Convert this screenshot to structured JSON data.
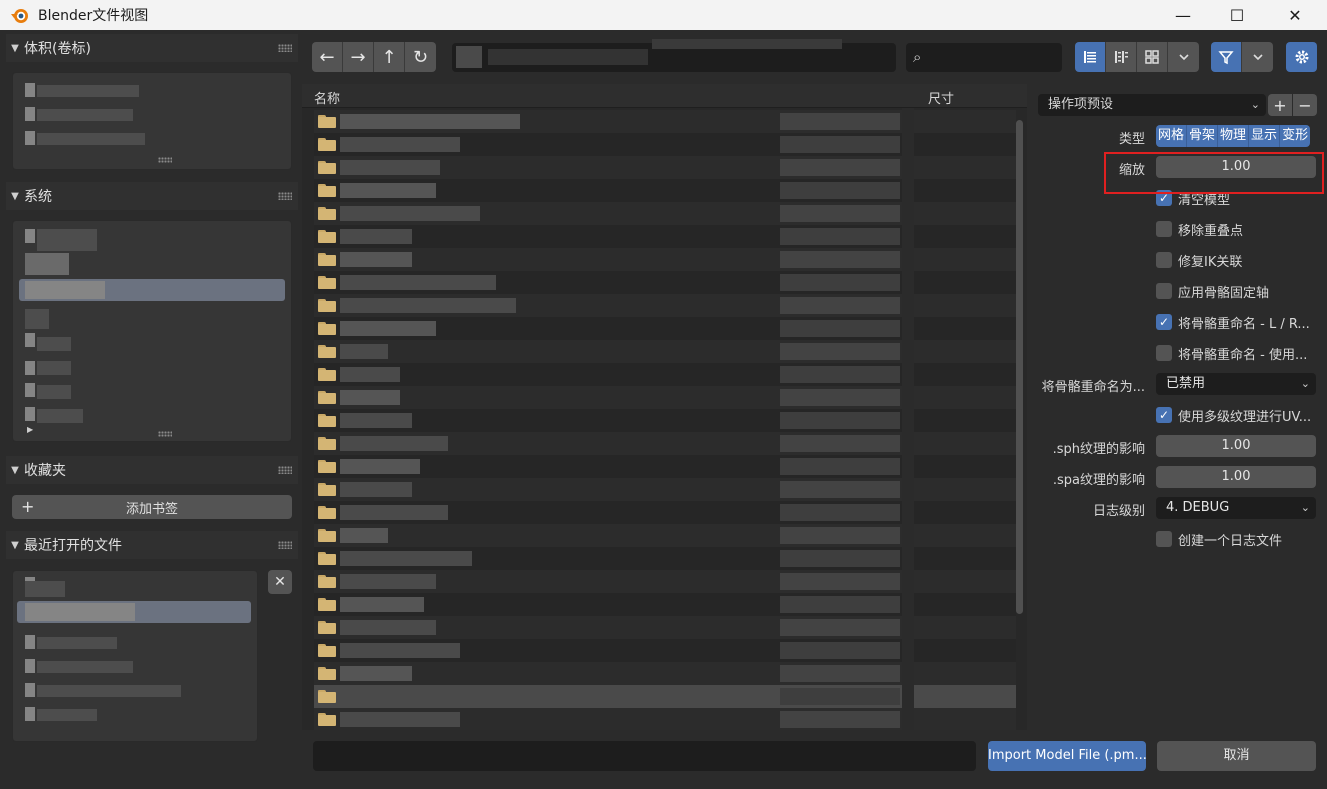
{
  "window": {
    "title": "Blender文件视图",
    "minimize_glyph": "—",
    "maximize_glyph": "☐",
    "close_glyph": "✕"
  },
  "sidebar": {
    "volumes_title": "体积(卷标)",
    "system_title": "系统",
    "favorites_title": "收藏夹",
    "add_bookmark_label": "添加书签",
    "recent_title": "最近打开的文件"
  },
  "toolbar": {
    "nav_icons": [
      "arrow-left-icon",
      "arrow-right-icon",
      "parent-directory-icon",
      "refresh-icon"
    ],
    "nav_glyphs": [
      "←",
      "→",
      "↑",
      "↻"
    ],
    "display_icons": [
      "list-vertical-icon",
      "list-horizontal-icon",
      "thumbnails-icon",
      "display-menu-chevron-icon"
    ],
    "filter_icon": "filter-icon",
    "settings_icon": "gear-icon"
  },
  "filelist": {
    "col_name": "名称",
    "col_size": "尺寸"
  },
  "operator": {
    "preset_label": "操作项预设",
    "type_label": "类型",
    "types": [
      "网格",
      "骨架",
      "物理",
      "显示",
      "变形"
    ],
    "scale_label": "缩放",
    "scale_value": "1.00",
    "checkboxes": [
      {
        "label": "清空模型",
        "checked": true
      },
      {
        "label": "移除重叠点",
        "checked": false
      },
      {
        "label": "修复IK关联",
        "checked": false
      },
      {
        "label": "应用骨骼固定轴",
        "checked": false
      },
      {
        "label": "将骨骼重命名 - L / R...",
        "checked": true
      },
      {
        "label": "将骨骼重命名 - 使用...",
        "checked": false
      }
    ],
    "rename_to_label": "将骨骼重命名为...",
    "rename_to_value": "已禁用",
    "mip_checkbox": {
      "label": "使用多级纹理进行UV...",
      "checked": true
    },
    "sph_label": ".sph纹理的影响",
    "sph_value": "1.00",
    "spa_label": ".spa纹理的影响",
    "spa_value": "1.00",
    "log_label": "日志级别",
    "log_value": "4. DEBUG",
    "logfile_checkbox": {
      "label": "创建一个日志文件",
      "checked": false
    }
  },
  "bottom": {
    "import_label": "Import Model File (.pm...",
    "cancel_label": "取消"
  },
  "colors": {
    "accent": "#4772b3",
    "folder": "#d4b574",
    "highlight": "#e02020"
  }
}
